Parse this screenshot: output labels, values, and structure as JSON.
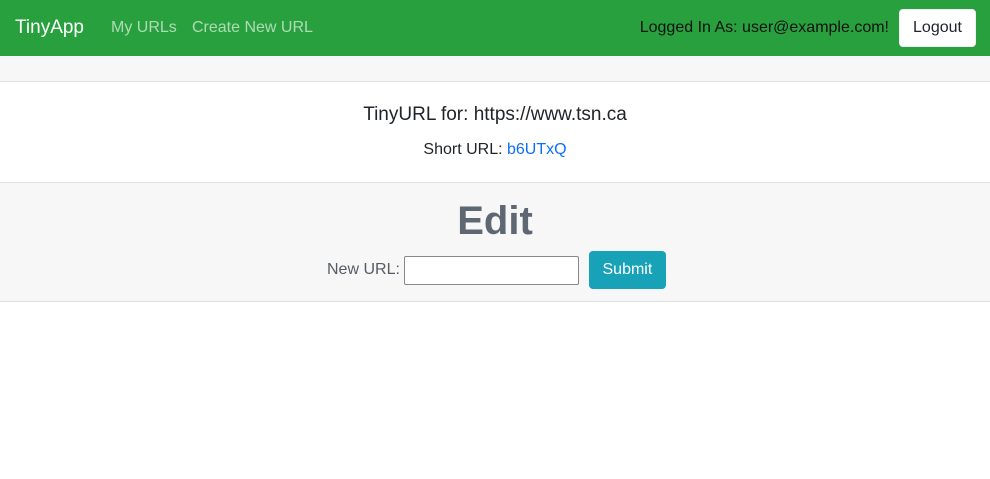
{
  "navbar": {
    "brand": "TinyApp",
    "links": [
      {
        "label": "My URLs"
      },
      {
        "label": "Create New URL"
      }
    ],
    "logged_in_text": "Logged In As: user@example.com!",
    "logout_label": "Logout",
    "background_color": "#28a03e"
  },
  "url_info": {
    "title": "TinyURL for: https://www.tsn.ca",
    "short_url_label": "Short URL:",
    "short_url_value": "b6UTxQ"
  },
  "edit": {
    "heading": "Edit",
    "new_url_label": "New URL:",
    "new_url_value": "",
    "submit_label": "Submit",
    "submit_color": "#17a2b8"
  }
}
